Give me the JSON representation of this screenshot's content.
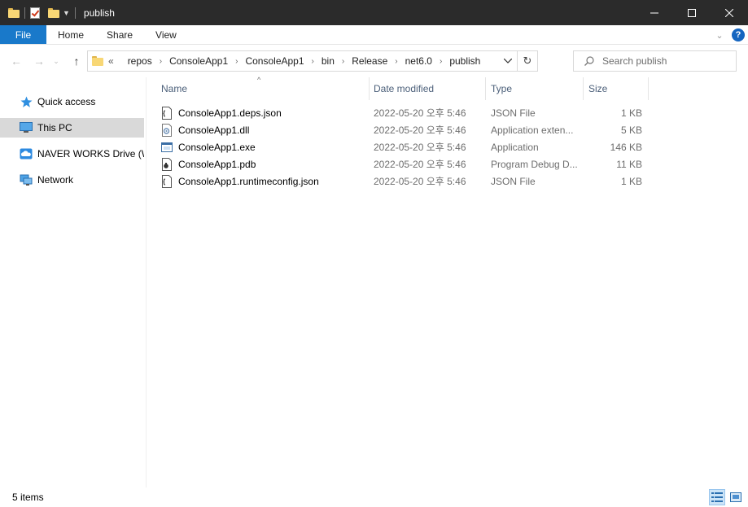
{
  "window": {
    "title": "publish",
    "minimize": "—",
    "maximize": "☐",
    "close": "✕"
  },
  "ribbon": {
    "tabs": [
      "File",
      "Home",
      "Share",
      "View"
    ],
    "help": "?"
  },
  "address": {
    "overflow": "«",
    "crumbs": [
      "repos",
      "ConsoleApp1",
      "ConsoleApp1",
      "bin",
      "Release",
      "net6.0",
      "publish"
    ],
    "search_placeholder": "Search publish"
  },
  "navigation": {
    "items": [
      {
        "label": "Quick access",
        "icon": "star-icon"
      },
      {
        "label": "This PC",
        "icon": "computer-icon",
        "selected": true
      },
      {
        "label": "NAVER WORKS Drive (W:)",
        "icon": "cloud-drive-icon"
      },
      {
        "label": "Network",
        "icon": "network-icon"
      }
    ]
  },
  "columns": {
    "name": "Name",
    "date": "Date modified",
    "type": "Type",
    "size": "Size"
  },
  "files": [
    {
      "name": "ConsoleApp1.deps.json",
      "date": "2022-05-20 오후 5:46",
      "type": "JSON File",
      "size": "1 KB",
      "icon": "json-file-icon"
    },
    {
      "name": "ConsoleApp1.dll",
      "date": "2022-05-20 오후 5:46",
      "type": "Application exten...",
      "size": "5 KB",
      "icon": "dll-file-icon"
    },
    {
      "name": "ConsoleApp1.exe",
      "date": "2022-05-20 오후 5:46",
      "type": "Application",
      "size": "146 KB",
      "icon": "exe-file-icon"
    },
    {
      "name": "ConsoleApp1.pdb",
      "date": "2022-05-20 오후 5:46",
      "type": "Program Debug D...",
      "size": "11 KB",
      "icon": "pdb-file-icon"
    },
    {
      "name": "ConsoleApp1.runtimeconfig.json",
      "date": "2022-05-20 오후 5:46",
      "type": "JSON File",
      "size": "1 KB",
      "icon": "json-file-icon"
    }
  ],
  "status": {
    "count": "5 items"
  },
  "colors": {
    "titlebar": "#2b2b2b",
    "file_tab": "#1979ca",
    "selection": "#d9d9d9",
    "header_text": "#4c607a"
  }
}
